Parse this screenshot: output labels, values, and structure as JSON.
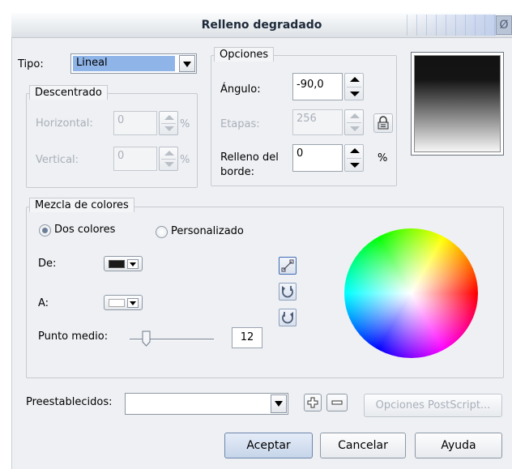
{
  "dialog": {
    "title": "Relleno degradado",
    "close_glyph": "Ø"
  },
  "type_row": {
    "label": "Tipo:",
    "value": "Lineal"
  },
  "offset_group": {
    "legend": "Descentrado",
    "horizontal_label": "Horizontal:",
    "horizontal_value": "0",
    "vertical_label": "Vertical:",
    "vertical_value": "0",
    "unit": "%"
  },
  "options_group": {
    "legend": "Opciones",
    "angle_label": "Ángulo:",
    "angle_value": "-90,0",
    "steps_label": "Etapas:",
    "steps_value": "256",
    "edge_pad_label_line1": "Relleno del",
    "edge_pad_label_line2": "borde:",
    "edge_pad_value": "0",
    "unit": "%"
  },
  "color_blend": {
    "legend": "Mezcla de colores",
    "radio_two_colors": "Dos colores",
    "radio_custom": "Personalizado",
    "selected_mode": "Dos colores",
    "from_label": "De:",
    "to_label": "A:",
    "from_color": "#1a1a1a",
    "to_color": "#ffffff",
    "midpoint_label": "Punto medio:",
    "midpoint_value": "12",
    "midpoint_fraction": 0.12,
    "tools": [
      "line-direction-icon",
      "counterclockwise-icon",
      "clockwise-icon"
    ]
  },
  "presets": {
    "label": "Preestablecidos:",
    "value": "",
    "postscript_button": "Opciones PostScript..."
  },
  "buttons": {
    "ok": "Aceptar",
    "cancel": "Cancelar",
    "help": "Ayuda"
  },
  "colors": {
    "selection_blue": "#8fb5e8",
    "preview_top": "#121212",
    "preview_bottom": "#ffffff"
  }
}
